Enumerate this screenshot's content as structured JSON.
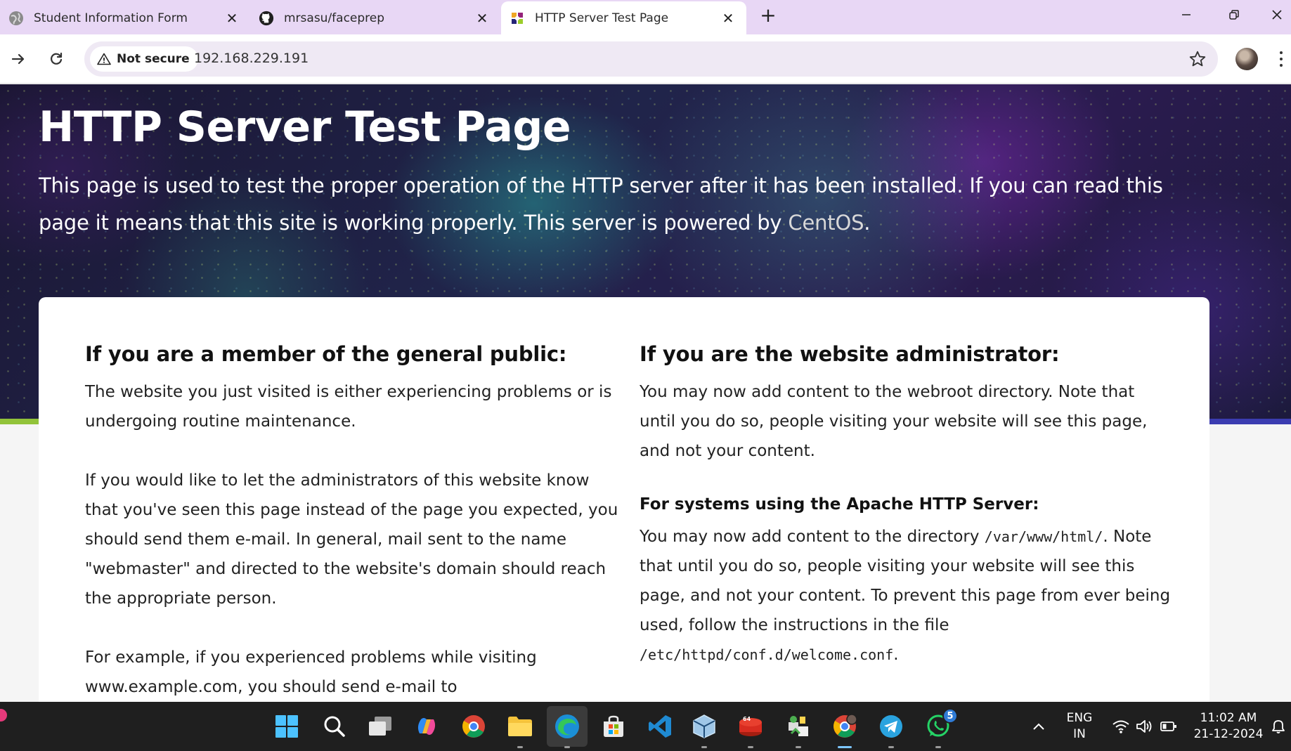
{
  "tabs": [
    {
      "title": "Student Information Form",
      "favicon": "globe-icon",
      "active": false
    },
    {
      "title": "mrsasu/faceprep",
      "favicon": "github-icon",
      "active": false
    },
    {
      "title": "HTTP Server Test Page",
      "favicon": "centos-icon",
      "active": true
    }
  ],
  "toolbar": {
    "security_label": "Not secure",
    "url": "192.168.229.191"
  },
  "page": {
    "title": "HTTP Server Test Page",
    "lead_before_link": "This page is used to test the proper operation of the HTTP server after it has been installed. If you can read this page it means that this site is working properly. This server is powered by ",
    "lead_link": "CentOS",
    "lead_after_link": ".",
    "public": {
      "heading": "If you are a member of the general public:",
      "p1": "The website you just visited is either experiencing problems or is undergoing routine maintenance.",
      "p2": "If you would like to let the administrators of this website know that you've seen this page instead of the page you expected, you should send them e-mail. In general, mail sent to the name \"webmaster\" and directed to the website's domain should reach the appropriate person.",
      "p3": "For example, if you experienced problems while visiting www.example.com, you should send e-mail to"
    },
    "admin": {
      "heading": "If you are the website administrator:",
      "p1": "You may now add content to the webroot directory. Note that until you do so, people visiting your website will see this page, and not your content.",
      "apache_heading": "For systems using the Apache HTTP Server:",
      "apache_p_before": "You may now add content to the directory ",
      "apache_dir": "/var/www/html/",
      "apache_p_middle": ". Note that until you do so, people visiting your website will see this page, and not your content. To prevent this page from ever being used, follow the instructions in the file ",
      "apache_file": "/etc/httpd/conf.d/welcome.conf",
      "apache_p_after": "."
    }
  },
  "taskbar": {
    "apps": [
      "start-icon",
      "search-icon",
      "task-view-icon",
      "copilot-icon",
      "chrome-icon",
      "file-explorer-icon",
      "edge-icon",
      "microsoft-store-icon",
      "vscode-icon",
      "virtualbox-icon",
      "redis-icon",
      "network-app-icon",
      "chrome-profile-icon",
      "telegram-icon",
      "whatsapp-icon"
    ],
    "whatsapp_badge": "5",
    "language_line1": "ENG",
    "language_line2": "IN",
    "time": "11:02 AM",
    "date": "21-12-2024"
  },
  "colors": {
    "tab_strip": "#e8d7f5",
    "omnibox": "#efe9f4",
    "hero_accent_green": "#92c33a",
    "hero_accent_blue": "#3b3cb0",
    "taskbar": "#1f1f1f"
  }
}
